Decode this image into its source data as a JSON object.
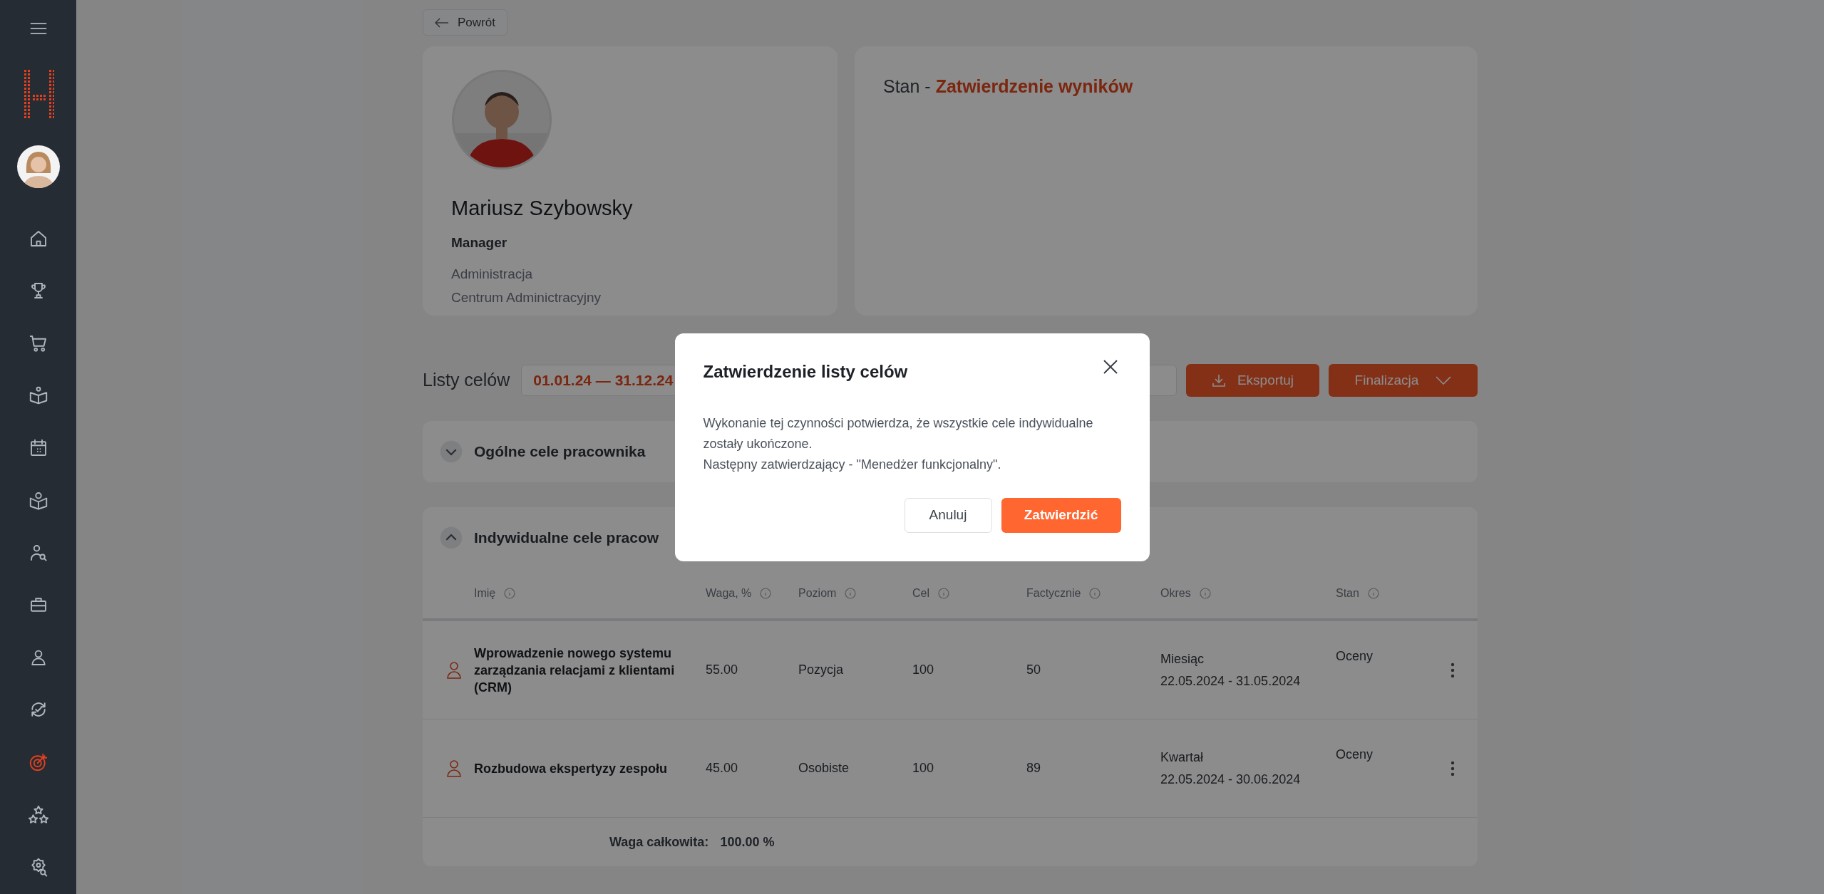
{
  "sidebar": {
    "items": [
      {
        "selected": false
      },
      {
        "selected": false
      },
      {
        "selected": false
      },
      {
        "selected": false
      },
      {
        "selected": false
      },
      {
        "selected": false
      },
      {
        "selected": false
      },
      {
        "selected": false
      },
      {
        "selected": false
      },
      {
        "selected": false
      },
      {
        "selected": true
      },
      {
        "selected": false
      },
      {
        "selected": false
      }
    ]
  },
  "back_button": "Powrót",
  "profile": {
    "name": "Mariusz Szybowsky",
    "role": "Manager",
    "department": "Administracja",
    "location": "Centrum Adminictracyjny"
  },
  "status": {
    "label": "Stan -",
    "value": "Zatwierdzenie wyników"
  },
  "goal_lists": {
    "label": "Listy celów",
    "period": "01.01.24 — 31.12.24",
    "export": "Eksportuj",
    "finalize": "Finalizacja"
  },
  "sections": [
    {
      "title": "Ogólne cele pracownika",
      "expanded": false
    },
    {
      "title": "Indywidualne cele pracow",
      "expanded": true
    }
  ],
  "table": {
    "columns": [
      "Imię",
      "Waga, %",
      "Poziom",
      "Cel",
      "Factycznie",
      "Okres",
      "Stan"
    ],
    "rows": [
      {
        "name": "Wprowadzenie nowego systemu zarządzania relacjami z klientami (CRM)",
        "weight": "55.00",
        "level": "Pozycja",
        "target": "100",
        "actual": "50",
        "period_type": "Miesiąc",
        "period_dates": "22.05.2024 - 31.05.2024",
        "state": "Oceny"
      },
      {
        "name": "Rozbudowa ekspertyzy zespołu",
        "weight": "45.00",
        "level": "Osobiste",
        "target": "100",
        "actual": "89",
        "period_type": "Kwartał",
        "period_dates": "22.05.2024 - 30.06.2024",
        "state": "Oceny"
      }
    ],
    "total_label": "Waga całkowita:",
    "total": "100.00 %"
  },
  "modal": {
    "title": "Zatwierdzenie listy celów",
    "paragraphs": [
      "Wykonanie tej czynności potwierdza, że wszystkie cele indywidualne zostały ukończone.",
      "Następny zatwierdzający - \"Menedżer funkcjonalny\"."
    ],
    "cancel": "Anuluj",
    "confirm": "Zatwierdzić"
  }
}
